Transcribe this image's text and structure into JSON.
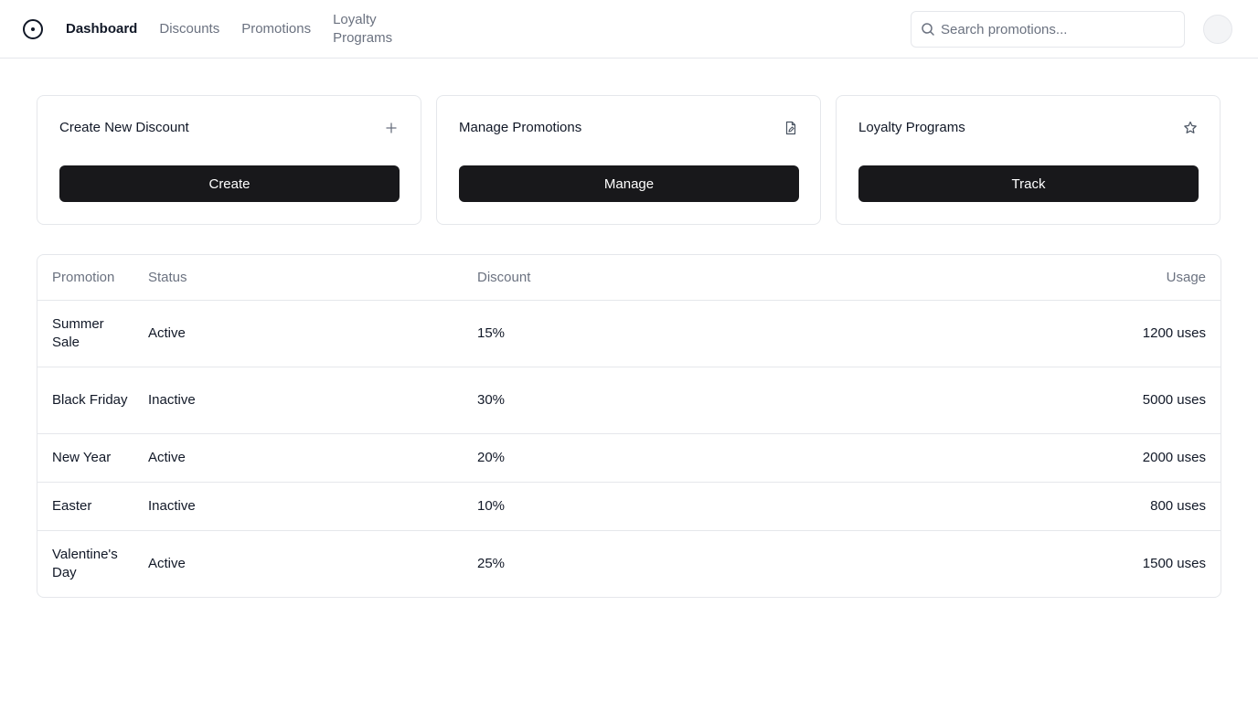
{
  "header": {
    "nav": [
      {
        "label": "Dashboard",
        "active": true
      },
      {
        "label": "Discounts",
        "active": false
      },
      {
        "label": "Promotions",
        "active": false
      },
      {
        "label": "Loyalty Programs",
        "active": false
      }
    ],
    "search": {
      "placeholder": "Search promotions...",
      "value": "",
      "icon": "search-icon"
    },
    "logo_icon": "circle-dot-logo-icon"
  },
  "cards": [
    {
      "title": "Create New Discount",
      "icon": "plus-icon",
      "button_label": "Create"
    },
    {
      "title": "Manage Promotions",
      "icon": "file-edit-icon",
      "button_label": "Manage"
    },
    {
      "title": "Loyalty Programs",
      "icon": "star-icon",
      "button_label": "Track"
    }
  ],
  "table": {
    "columns": [
      "Promotion",
      "Status",
      "Discount",
      "Usage"
    ],
    "rows": [
      {
        "promotion": "Summer Sale",
        "status": "Active",
        "discount": "15%",
        "usage": "1200 uses"
      },
      {
        "promotion": "Black Friday",
        "status": "Inactive",
        "discount": "30%",
        "usage": "5000 uses"
      },
      {
        "promotion": "New Year",
        "status": "Active",
        "discount": "20%",
        "usage": "2000 uses"
      },
      {
        "promotion": "Easter",
        "status": "Inactive",
        "discount": "10%",
        "usage": "800 uses"
      },
      {
        "promotion": "Valentine's Day",
        "status": "Active",
        "discount": "25%",
        "usage": "1500 uses"
      }
    ]
  },
  "colors": {
    "primary_button": "#18181b",
    "border": "#e5e7eb",
    "muted_text": "#6b7280"
  }
}
